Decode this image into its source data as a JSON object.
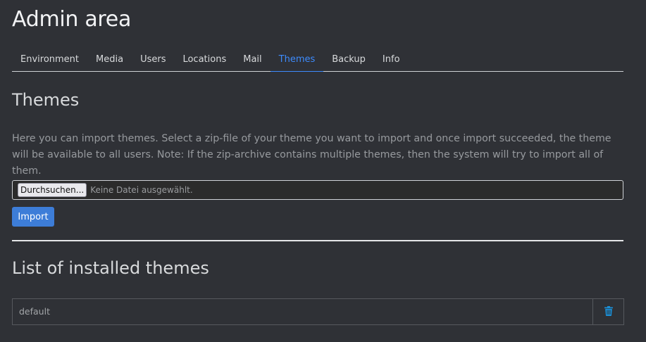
{
  "page": {
    "title": "Admin area"
  },
  "tabs": [
    {
      "label": "Environment",
      "active": false
    },
    {
      "label": "Media",
      "active": false
    },
    {
      "label": "Users",
      "active": false
    },
    {
      "label": "Locations",
      "active": false
    },
    {
      "label": "Mail",
      "active": false
    },
    {
      "label": "Themes",
      "active": true
    },
    {
      "label": "Backup",
      "active": false
    },
    {
      "label": "Info",
      "active": false
    }
  ],
  "themes_section": {
    "title": "Themes",
    "description": "Here you can import themes. Select a zip-file of your theme you want to import and once import succeeded, the theme will be available to all users. Note: If the zip-archive contains multiple themes, then the system will try to import all of them.",
    "file_input": {
      "button_label": "Durchsuchen...",
      "status_text": "Keine Datei ausgewählt."
    },
    "import_label": "Import"
  },
  "installed_section": {
    "title": "List of installed themes",
    "items": [
      {
        "name": "default",
        "action_icon": "trash-icon"
      }
    ]
  },
  "colors": {
    "background": "#2f3136",
    "accent": "#3d7dd8",
    "active_tab": "#3d8bfd",
    "delete_icon": "#1a8fd6"
  }
}
